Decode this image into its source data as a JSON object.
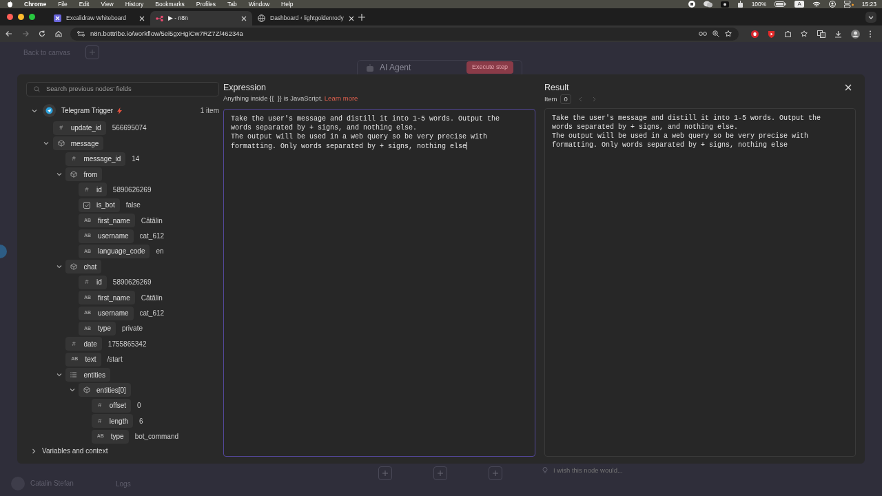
{
  "menubar": {
    "app": "Chrome",
    "menus": [
      "File",
      "Edit",
      "View",
      "History",
      "Bookmarks",
      "Profiles",
      "Tab",
      "Window",
      "Help"
    ],
    "battery": "100%",
    "input_source": "A",
    "time": "15:23"
  },
  "tabs": [
    {
      "title": "Excalidraw Whiteboard",
      "selected": false
    },
    {
      "title": "▶ - n8n",
      "selected": true
    },
    {
      "title": "Dashboard ‹ lightgoldenrody",
      "selected": false
    }
  ],
  "address_bar": {
    "url": "n8n.bottribe.io/workflow/5ei5gxHgiCw7RZ7Z/46234a"
  },
  "canvas": {
    "back_link": "Back to canvas",
    "node_title": "AI Agent",
    "execute_button": "Execute step",
    "feedback_placeholder": "I wish this node would...",
    "user_name": "Catalin Stefan",
    "logs": "Logs"
  },
  "modal": {
    "search_placeholder": "Search previous nodes' fields",
    "tree": {
      "name": "Telegram Trigger",
      "count": "1 item",
      "expanded": true,
      "children": [
        {
          "kind": "number",
          "badge": "#",
          "key": "update_id",
          "value": "566695074"
        },
        {
          "kind": "object",
          "key": "message",
          "expanded": true,
          "children": [
            {
              "kind": "number",
              "badge": "#",
              "key": "message_id",
              "value": "14"
            },
            {
              "kind": "object",
              "key": "from",
              "expanded": true,
              "children": [
                {
                  "kind": "number",
                  "badge": "#",
                  "key": "id",
                  "value": "5890626269"
                },
                {
                  "kind": "boolean",
                  "key": "is_bot",
                  "value": "false"
                },
                {
                  "kind": "string",
                  "badge": "AB",
                  "key": "first_name",
                  "value": "Cătălin"
                },
                {
                  "kind": "string",
                  "badge": "AB",
                  "key": "username",
                  "value": "cat_612"
                },
                {
                  "kind": "string",
                  "badge": "AB",
                  "key": "language_code",
                  "value": "en"
                }
              ]
            },
            {
              "kind": "object",
              "key": "chat",
              "expanded": true,
              "children": [
                {
                  "kind": "number",
                  "badge": "#",
                  "key": "id",
                  "value": "5890626269"
                },
                {
                  "kind": "string",
                  "badge": "AB",
                  "key": "first_name",
                  "value": "Cătălin"
                },
                {
                  "kind": "string",
                  "badge": "AB",
                  "key": "username",
                  "value": "cat_612"
                },
                {
                  "kind": "string",
                  "badge": "AB",
                  "key": "type",
                  "value": "private"
                }
              ]
            },
            {
              "kind": "number",
              "badge": "#",
              "key": "date",
              "value": "1755865342"
            },
            {
              "kind": "string",
              "badge": "AB",
              "key": "text",
              "value": "/start"
            },
            {
              "kind": "array",
              "key": "entities",
              "expanded": true,
              "children": [
                {
                  "kind": "object",
                  "key": "entities[0]",
                  "expanded": true,
                  "children": [
                    {
                      "kind": "number",
                      "badge": "#",
                      "key": "offset",
                      "value": "0"
                    },
                    {
                      "kind": "number",
                      "badge": "#",
                      "key": "length",
                      "value": "6"
                    },
                    {
                      "kind": "string",
                      "badge": "AB",
                      "key": "type",
                      "value": "bot_command"
                    }
                  ]
                }
              ]
            }
          ]
        }
      ]
    },
    "variables": {
      "label": "Variables and context",
      "expanded": false
    },
    "expression": {
      "title": "Expression",
      "hint": "Anything inside {{  }} is JavaScript.",
      "link": "Learn more",
      "text": "Take the user's message and distill it into 1-5 words. Output the words separated by + signs, and nothing else.\nThe output will be used in a web query so be very precise with formatting. Only words separated by + signs, nothing else"
    },
    "result": {
      "title": "Result",
      "item_label": "Item",
      "item_value": "0",
      "prev_enabled": false,
      "next_enabled": false,
      "text": "Take the user's message and distill it into 1-5 words. Output the words separated by + signs, and nothing else.\nThe output will be used in a web query so be very precise with formatting. Only words separated by + signs, nothing else"
    }
  }
}
